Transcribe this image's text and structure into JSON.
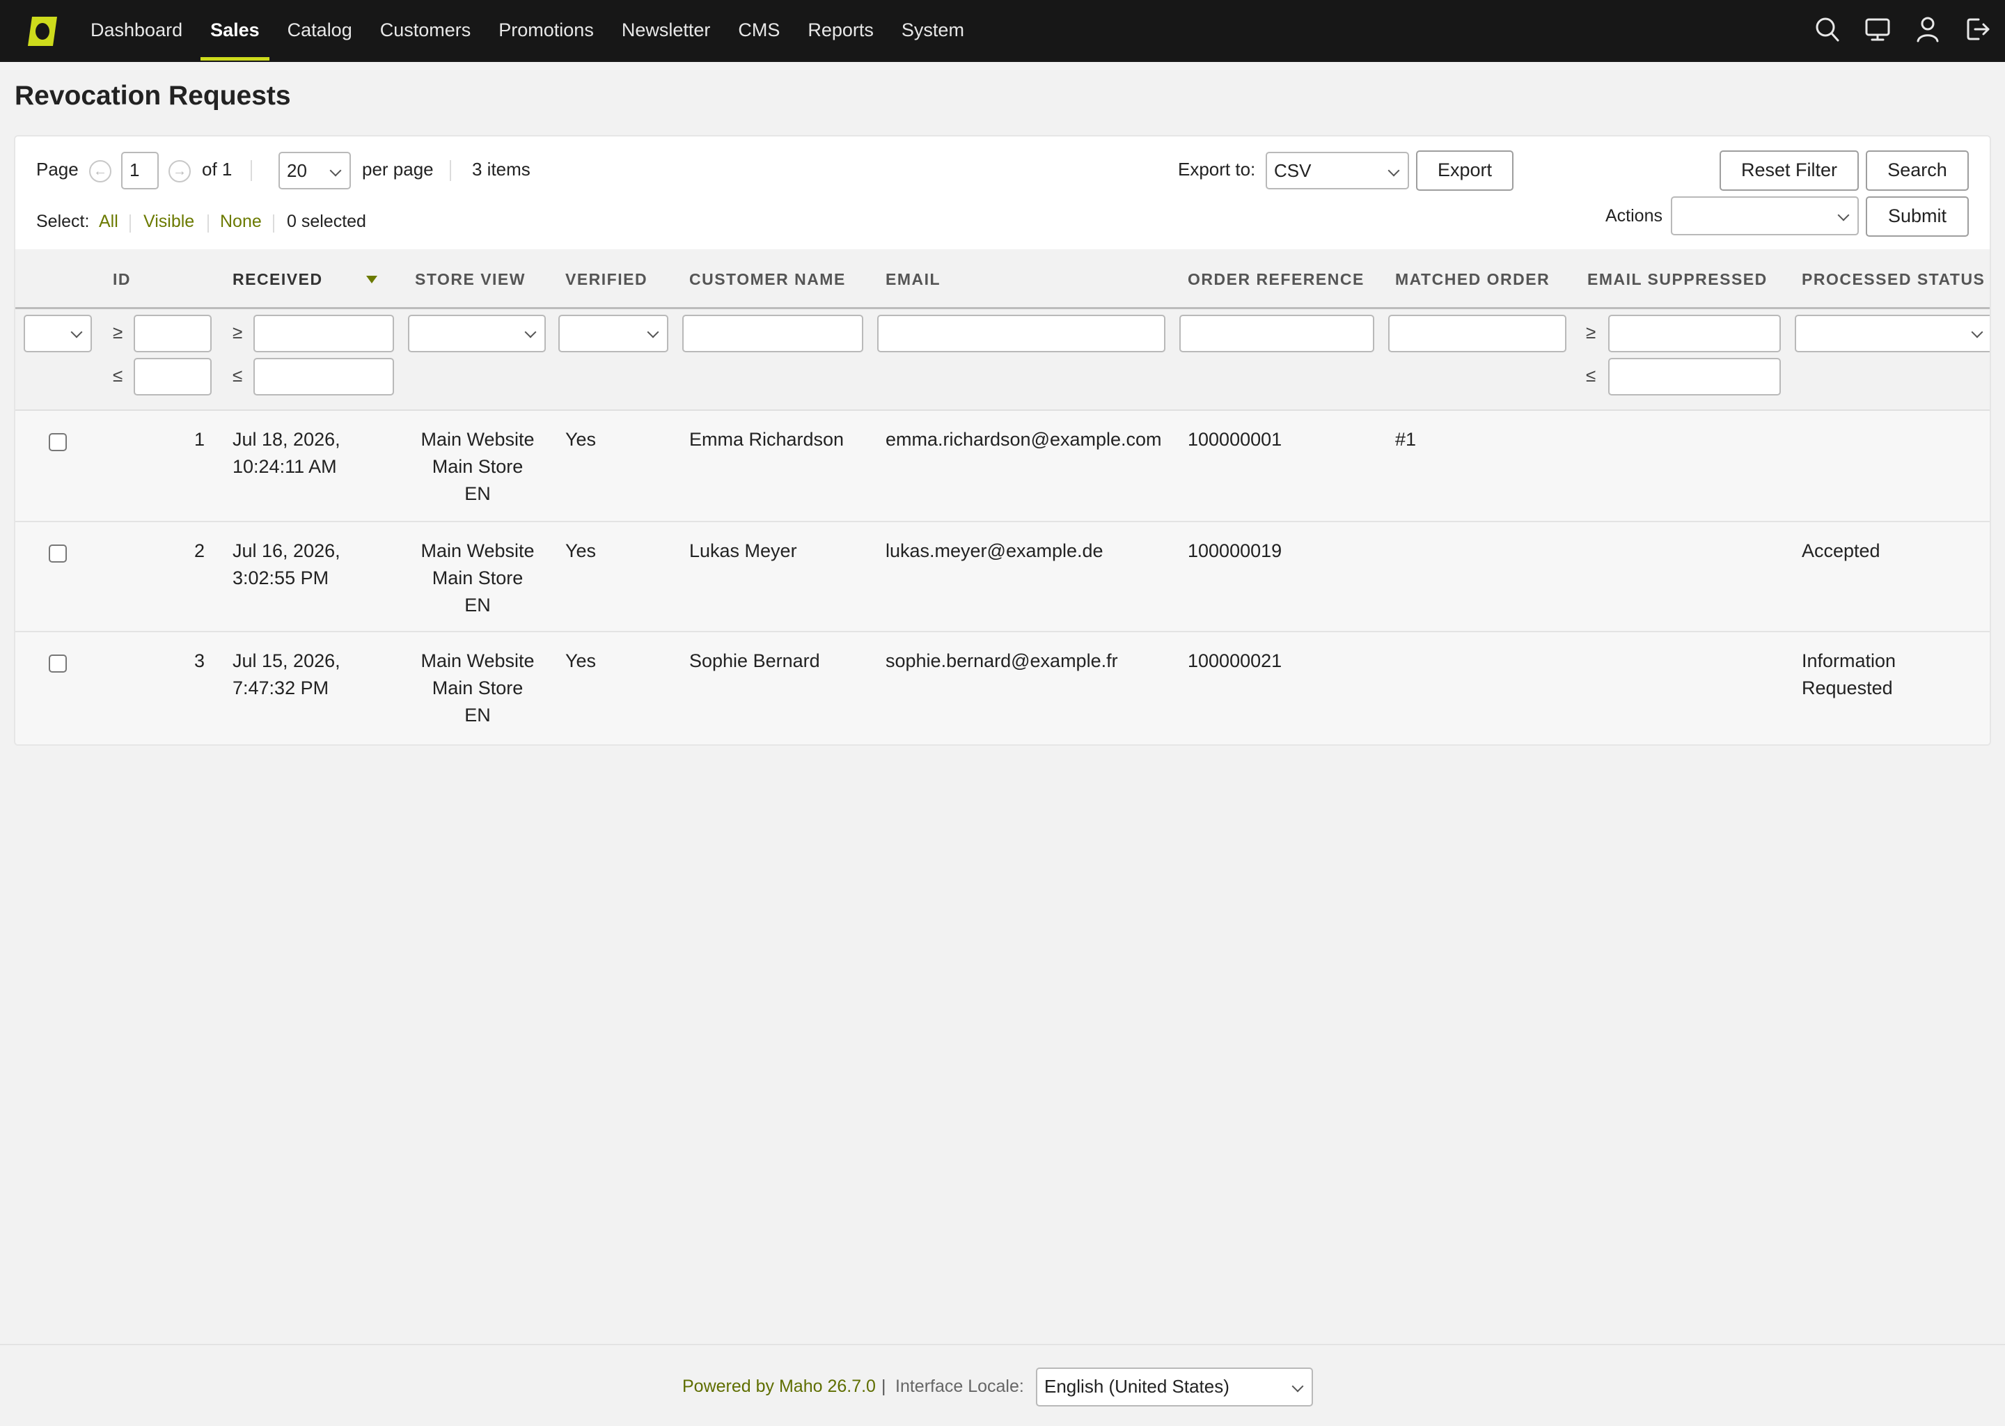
{
  "nav": {
    "items": [
      {
        "label": "Dashboard"
      },
      {
        "label": "Sales",
        "active": true
      },
      {
        "label": "Catalog"
      },
      {
        "label": "Customers"
      },
      {
        "label": "Promotions"
      },
      {
        "label": "Newsletter"
      },
      {
        "label": "CMS"
      },
      {
        "label": "Reports"
      },
      {
        "label": "System"
      }
    ],
    "icons": [
      "search-icon",
      "monitor-icon",
      "user-icon",
      "logout-icon"
    ],
    "accent_color": "#cddb1c"
  },
  "page": {
    "title": "Revocation Requests"
  },
  "pager": {
    "page_label": "Page",
    "page_value": "1",
    "of_label": "of 1",
    "per_page_value": "20",
    "per_page_label": "per page",
    "items_count": "3 items"
  },
  "export": {
    "label": "Export to:",
    "format": "CSV",
    "button": "Export"
  },
  "buttons": {
    "reset_filter": "Reset Filter",
    "search": "Search",
    "submit": "Submit"
  },
  "actions": {
    "label": "Actions",
    "value": ""
  },
  "select": {
    "label": "Select:",
    "all": "All",
    "visible": "Visible",
    "none": "None",
    "selected_count": "0 selected"
  },
  "columns": {
    "id": "ID",
    "received": "RECEIVED",
    "store_view": "STORE VIEW",
    "verified": "VERIFIED",
    "customer_name": "CUSTOMER NAME",
    "email": "EMAIL",
    "order_reference": "ORDER REFERENCE",
    "matched_order": "MATCHED ORDER",
    "email_suppressed": "EMAIL SUPPRESSED",
    "processed_status": "PROCESSED STATUS"
  },
  "filters": {
    "gte": "≥",
    "lte": "≤"
  },
  "rows": [
    {
      "id": "1",
      "received_date": "Jul 18, 2026,",
      "received_time": "10:24:11 AM",
      "store_website": "Main Website",
      "store_name": "Main Store",
      "store_view": "EN",
      "verified": "Yes",
      "customer_name": "Emma Richardson",
      "email": "emma.richardson@example.com",
      "order_reference": "100000001",
      "matched_order": "#1",
      "email_suppressed": "",
      "status_line1": "",
      "status_line2": ""
    },
    {
      "id": "2",
      "received_date": "Jul 16, 2026,",
      "received_time": "3:02:55 PM",
      "store_website": "Main Website",
      "store_name": "Main Store",
      "store_view": "EN",
      "verified": "Yes",
      "customer_name": "Lukas Meyer",
      "email": "lukas.meyer@example.de",
      "order_reference": "100000019",
      "matched_order": "",
      "email_suppressed": "",
      "status_line1": "Accepted",
      "status_line2": ""
    },
    {
      "id": "3",
      "received_date": "Jul 15, 2026,",
      "received_time": "7:47:32 PM",
      "store_website": "Main Website",
      "store_name": "Main Store",
      "store_view": "EN",
      "verified": "Yes",
      "customer_name": "Sophie Bernard",
      "email": "sophie.bernard@example.fr",
      "order_reference": "100000021",
      "matched_order": "",
      "email_suppressed": "",
      "status_line1": "Information",
      "status_line2": "Requested"
    }
  ],
  "footer": {
    "powered_by": "Powered by Maho 26.7.0",
    "separator": "|",
    "locale_label": "Interface Locale:",
    "locale_value": "English (United States)"
  }
}
